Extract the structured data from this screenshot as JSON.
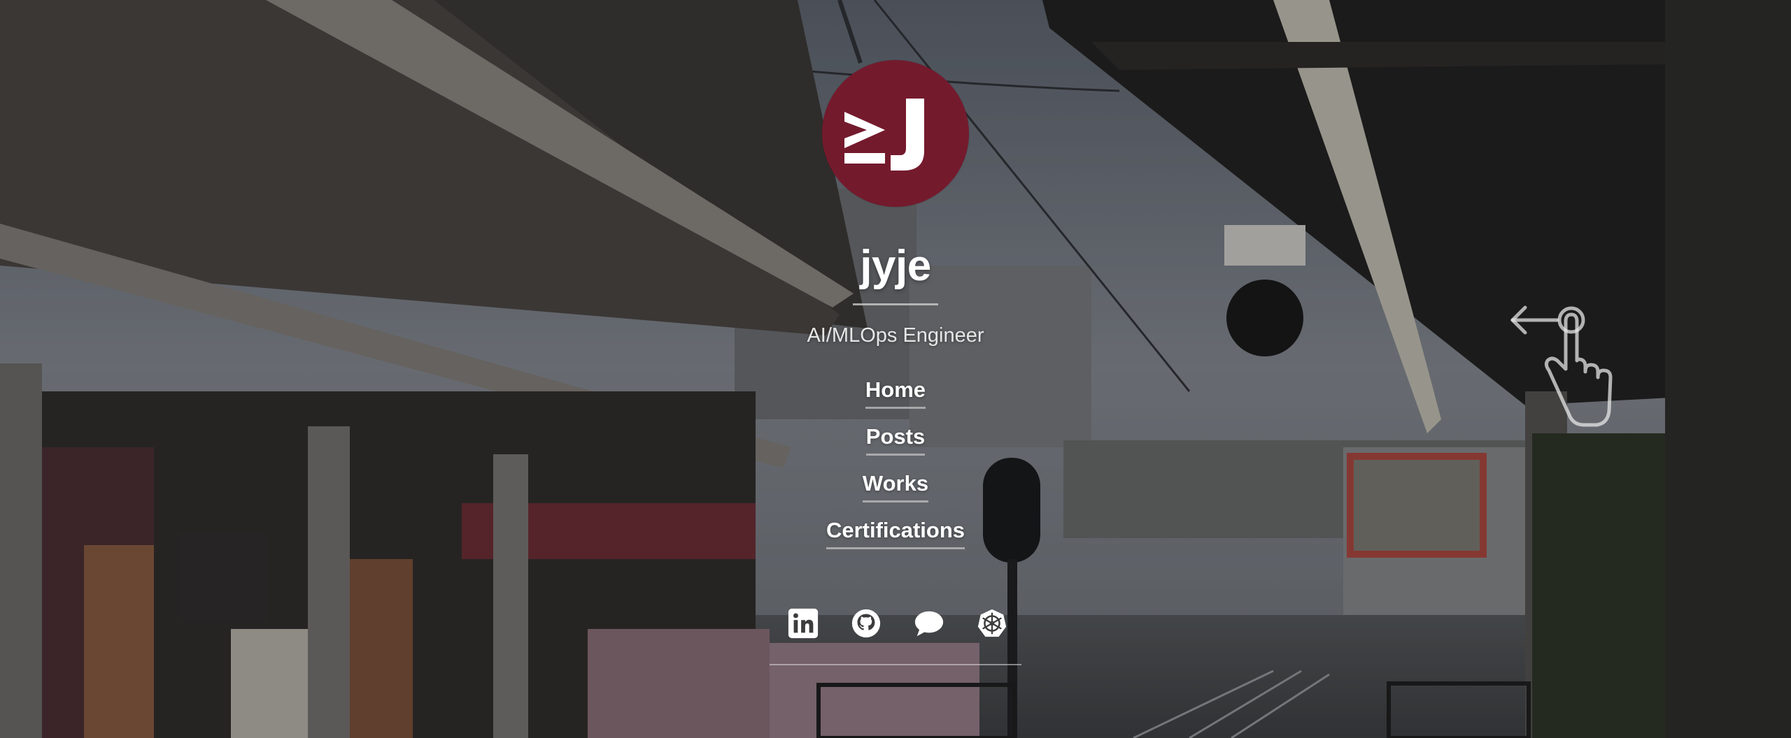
{
  "profile": {
    "logo_text": "≥J",
    "name": "jyje",
    "role": "AI/MLOps Engineer",
    "avatar_color": "#741a2d"
  },
  "nav": {
    "items": [
      {
        "label": "Home"
      },
      {
        "label": "Posts"
      },
      {
        "label": "Works"
      },
      {
        "label": "Certifications"
      }
    ]
  },
  "social": {
    "links": [
      {
        "icon": "linkedin-icon"
      },
      {
        "icon": "github-icon"
      },
      {
        "icon": "chat-bubble-icon"
      },
      {
        "icon": "kubernetes-helm-icon"
      }
    ]
  },
  "hint": {
    "icon": "swipe-left-hand-icon"
  },
  "colors": {
    "text": "#ffffff",
    "subtext": "#e6e6e6",
    "accent": "#741a2d"
  }
}
